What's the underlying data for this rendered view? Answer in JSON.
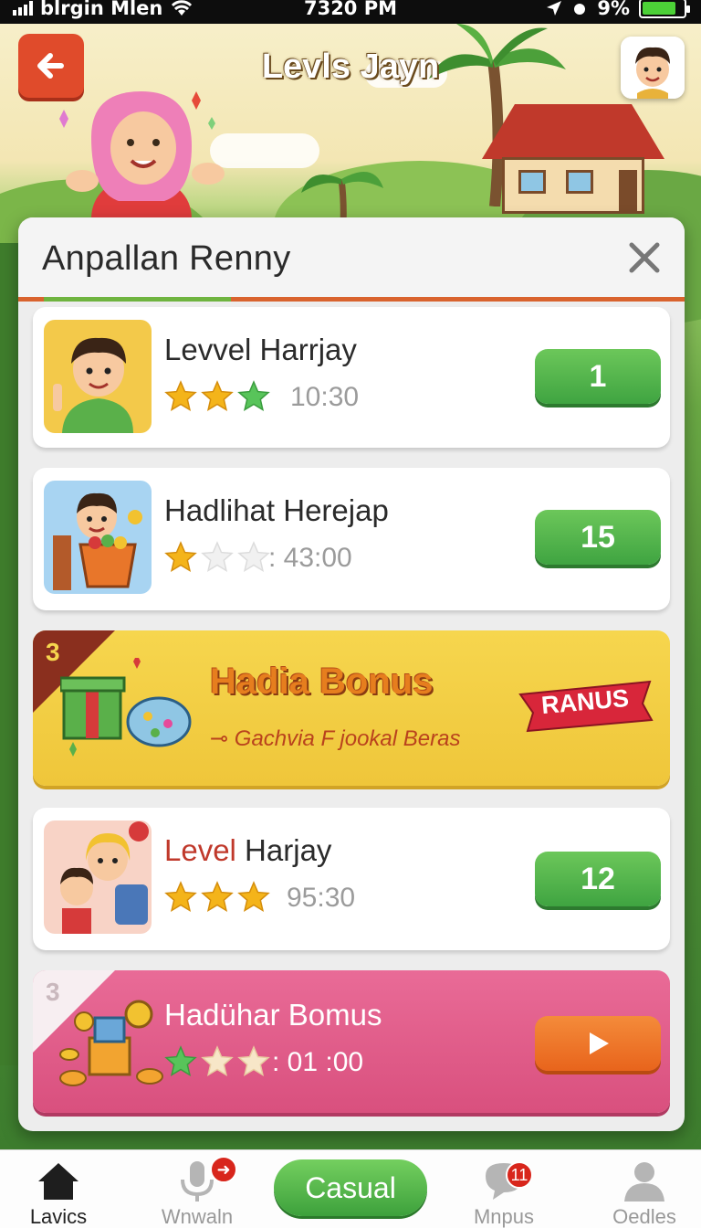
{
  "status_bar": {
    "carrier": "blrgin Mlen",
    "time": "7320 PM",
    "battery": "9%"
  },
  "header": {
    "title": "Levls Jayn"
  },
  "panel": {
    "title": "Anpallan Renny",
    "items": [
      {
        "type": "level",
        "name": "Levvel Harrjay",
        "stars": [
          "gold",
          "gold",
          "green"
        ],
        "time": "10:30",
        "button": "1"
      },
      {
        "type": "level",
        "name": "Hadlihat Herejap",
        "stars": [
          "gold",
          "empty",
          "empty"
        ],
        "time": ": 43:00",
        "button": "15"
      },
      {
        "type": "bonus",
        "corner": "3",
        "title": "Hadia Bonus",
        "subtitle": "Gachvia F jookal Beras",
        "ribbon": "RANUS"
      },
      {
        "type": "level",
        "name_a": "Level",
        "name_b": " Harjay",
        "stars": [
          "gold",
          "gold",
          "gold"
        ],
        "time": "95:30",
        "button": "12"
      },
      {
        "type": "bonus2",
        "corner": "3",
        "name": "Hadühar Bomus",
        "stars": [
          "green",
          "light",
          "light"
        ],
        "time": ": 01 :00"
      }
    ]
  },
  "nav": {
    "items": [
      {
        "label": "Lavics",
        "icon": "home-icon",
        "active": true
      },
      {
        "label": "Wnwaln",
        "icon": "microphone-icon"
      },
      {
        "label": "Casual"
      },
      {
        "label": "Mnpus",
        "icon": "chat-icon",
        "badge": "11"
      },
      {
        "label": "Oedles",
        "icon": "profile-icon"
      }
    ]
  },
  "colors": {
    "accent_green": "#4caf50",
    "accent_orange": "#e8641c",
    "back_red": "#e04b2b",
    "bonus_yellow": "#f3cf45",
    "bonus_pink": "#df5a88"
  }
}
